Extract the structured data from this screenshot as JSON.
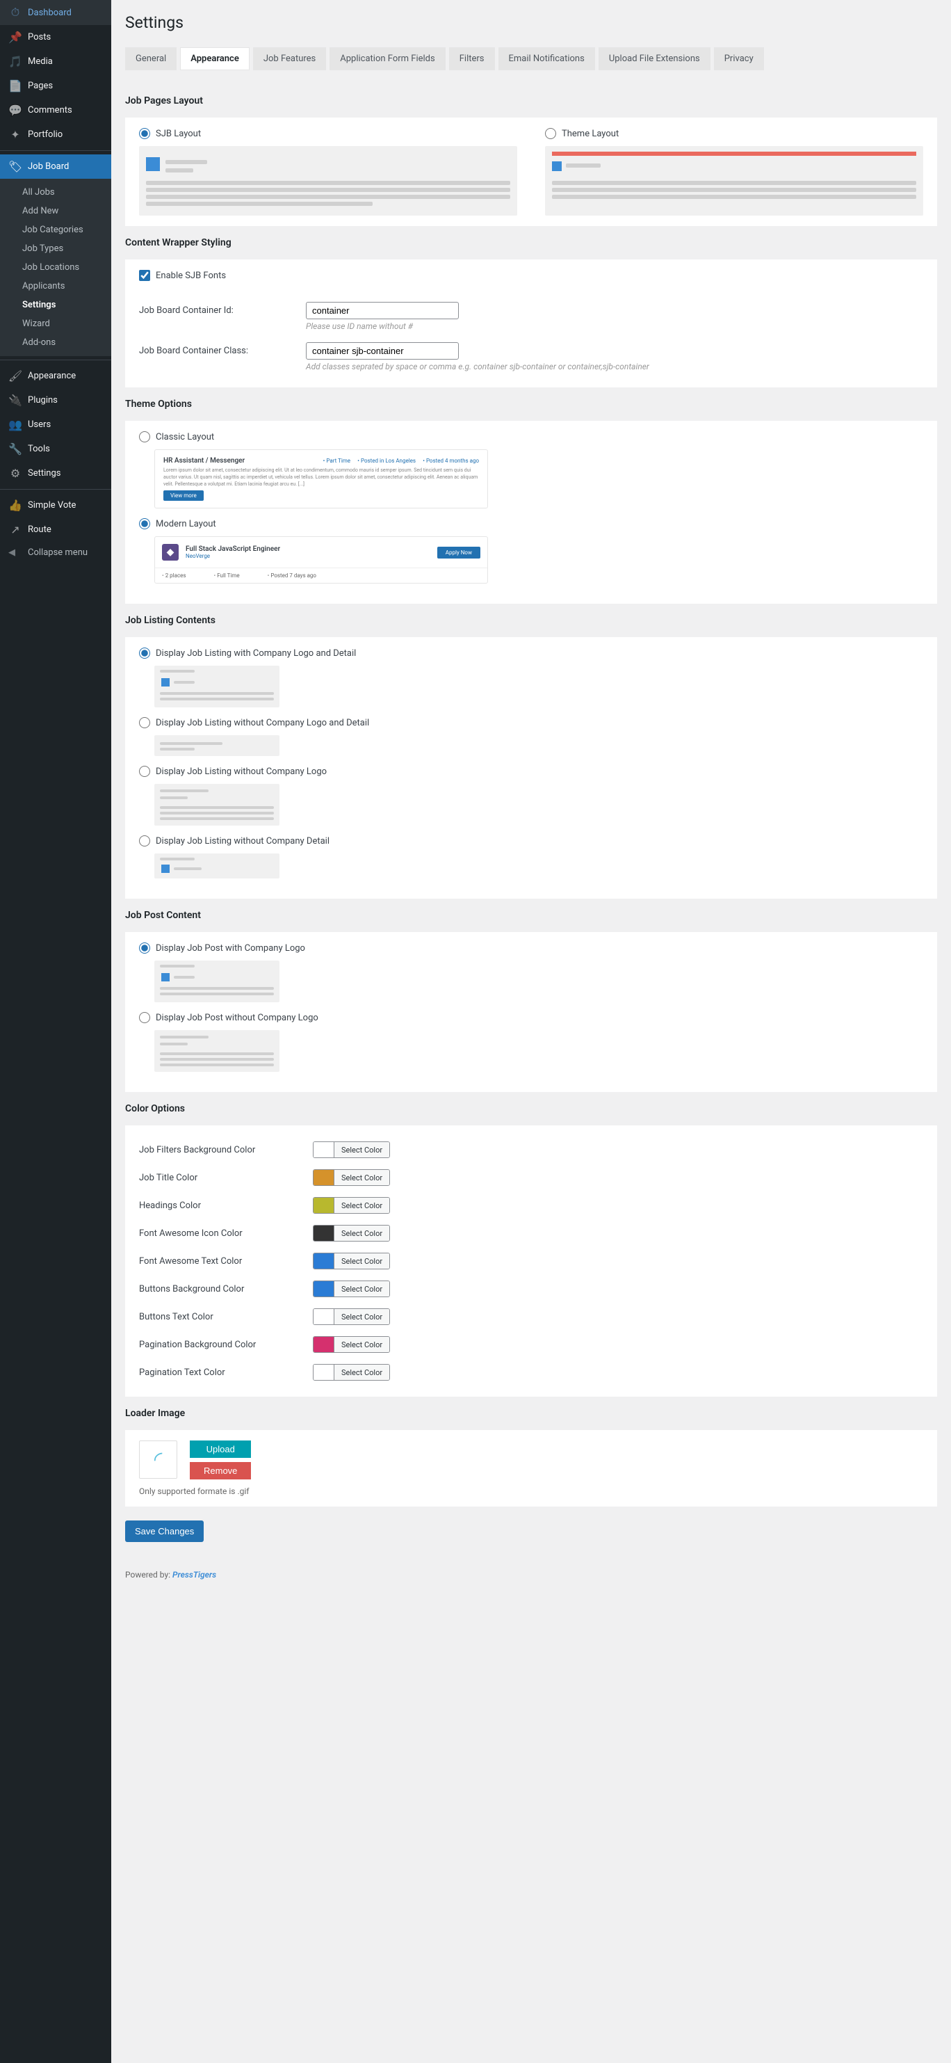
{
  "sidebar": {
    "items": [
      {
        "label": "Dashboard",
        "icon": "dashboard"
      },
      {
        "label": "Posts",
        "icon": "pin"
      },
      {
        "label": "Media",
        "icon": "media"
      },
      {
        "label": "Pages",
        "icon": "pages"
      },
      {
        "label": "Comments",
        "icon": "comment"
      },
      {
        "label": "Portfolio",
        "icon": "portfolio"
      },
      {
        "label": "Job Board",
        "icon": "tag",
        "active": true
      },
      {
        "label": "Appearance",
        "icon": "brush"
      },
      {
        "label": "Plugins",
        "icon": "plug"
      },
      {
        "label": "Users",
        "icon": "users"
      },
      {
        "label": "Tools",
        "icon": "wrench"
      },
      {
        "label": "Settings",
        "icon": "gear"
      },
      {
        "label": "Simple Vote",
        "icon": "thumb"
      },
      {
        "label": "Route",
        "icon": "route"
      }
    ],
    "submenu": [
      "All Jobs",
      "Add New",
      "Job Categories",
      "Job Types",
      "Job Locations",
      "Applicants",
      "Settings",
      "Wizard",
      "Add-ons"
    ],
    "submenu_current": "Settings",
    "collapse": "Collapse menu"
  },
  "page": {
    "title": "Settings"
  },
  "tabs": [
    "General",
    "Appearance",
    "Job Features",
    "Application Form Fields",
    "Filters",
    "Email Notifications",
    "Upload File Extensions",
    "Privacy"
  ],
  "active_tab": "Appearance",
  "sections": {
    "pages_layout": {
      "title": "Job Pages Layout",
      "sjb": "SJB Layout",
      "theme": "Theme Layout"
    },
    "wrapper": {
      "title": "Content Wrapper Styling",
      "enable_fonts": "Enable SJB Fonts",
      "container_id_label": "Job Board Container Id:",
      "container_id_value": "container",
      "container_id_hint": "Please use ID name without #",
      "container_class_label": "Job Board Container Class:",
      "container_class_value": "container sjb-container",
      "container_class_hint": "Add classes seprated by space or comma e.g. container sjb-container or container,sjb-container"
    },
    "theme_options": {
      "title": "Theme Options",
      "classic": "Classic Layout",
      "modern": "Modern Layout",
      "classic_preview": {
        "title": "HR Assistant / Messenger",
        "m1": "Part Time",
        "m2": "Posted in Los Angeles",
        "m3": "Posted 4 months ago",
        "body": "Lorem ipsum dolor sit amet, consectetur adipiscing elit. Ut at leo condimentum, commodo mauris id semper ipsum. Sed tincidunt sem quis dui auctor varius. Ut quam nisl, sagittis ac imperdiet ut, vehicula vel tellus. Lorem ipsum dolor sit amet, consectetur adipiscing elit. Aenean ac aliquam velit. Pellentesque a volutpat mi. Etiam lacinia feugiat arcu eu. [...]",
        "btn": "View more"
      },
      "modern_preview": {
        "title": "Full Stack JavaScript Engineer",
        "company": "NeoVerge",
        "apply": "Apply Now",
        "f1": "2 places",
        "f2": "Full Time",
        "f3": "Posted 7 days ago"
      }
    },
    "listing": {
      "title": "Job Listing Contents",
      "o1": "Display Job Listing with Company Logo and Detail",
      "o2": "Display Job Listing without Company Logo and Detail",
      "o3": "Display Job Listing without Company Logo",
      "o4": "Display Job Listing without Company Detail"
    },
    "post": {
      "title": "Job Post Content",
      "o1": "Display Job Post with Company Logo",
      "o2": "Display Job Post without Company Logo"
    },
    "colors": {
      "title": "Color Options",
      "btn": "Select Color",
      "rows": [
        {
          "label": "Job Filters Background Color",
          "color": "#ffffff"
        },
        {
          "label": "Job Title Color",
          "color": "#d5922b"
        },
        {
          "label": "Headings Color",
          "color": "#b8b82e"
        },
        {
          "label": "Font Awesome Icon Color",
          "color": "#333333"
        },
        {
          "label": "Font Awesome Text Color",
          "color": "#2b7cd5"
        },
        {
          "label": "Buttons Background Color",
          "color": "#2b7cd5"
        },
        {
          "label": "Buttons Text Color",
          "color": "#ffffff"
        },
        {
          "label": "Pagination Background Color",
          "color": "#d5306e"
        },
        {
          "label": "Pagination Text Color",
          "color": "#ffffff"
        }
      ]
    },
    "loader": {
      "title": "Loader Image",
      "upload": "Upload",
      "remove": "Remove",
      "hint": "Only supported formate is .gif"
    }
  },
  "save": "Save Changes",
  "footer": {
    "prefix": "Powered by:",
    "brand": "PressTigers"
  }
}
